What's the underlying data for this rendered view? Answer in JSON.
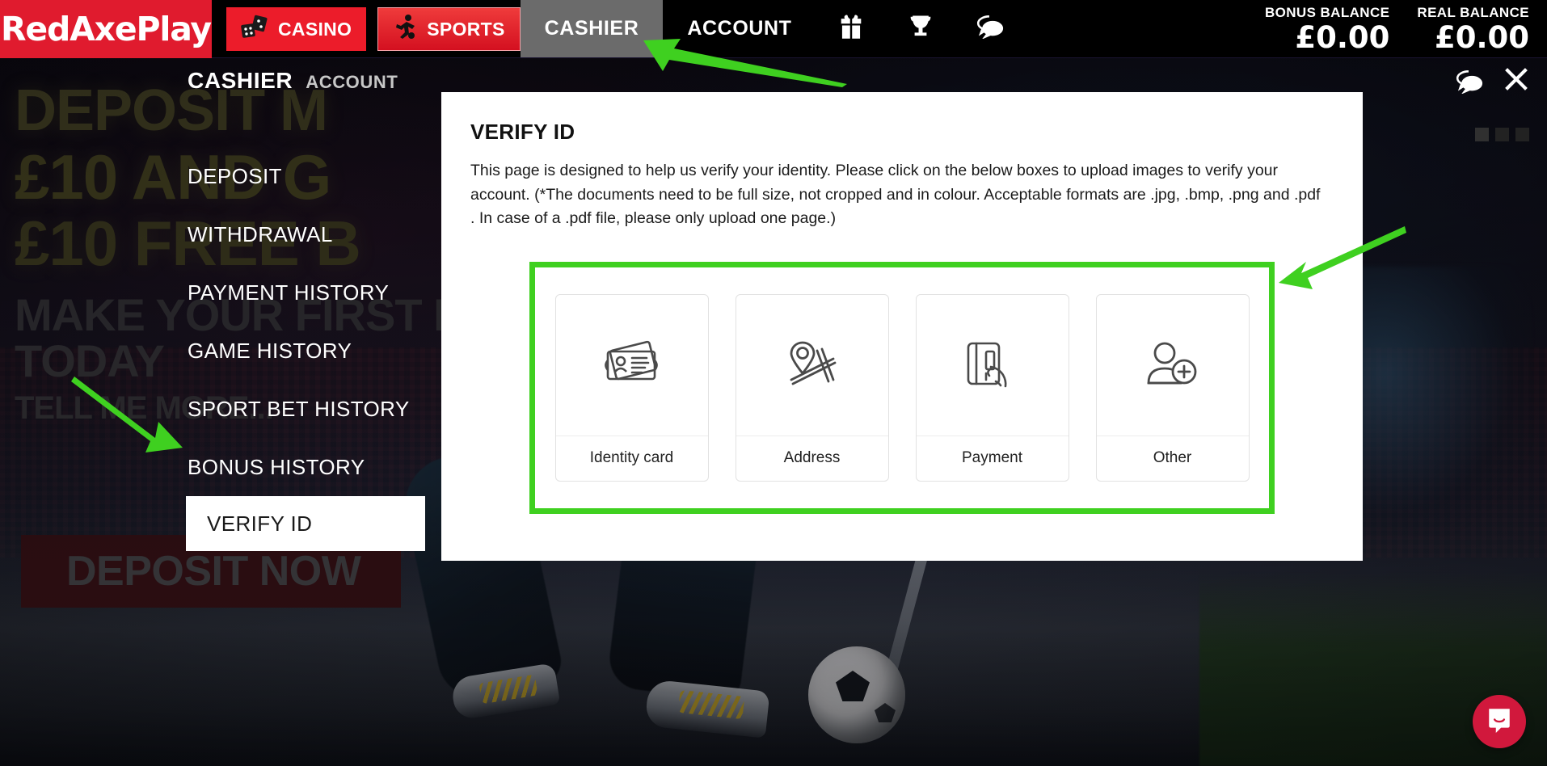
{
  "brand": {
    "name": "RedAxePlay",
    "accent": "#e01b2e",
    "highlight_green": "#3fd020"
  },
  "topnav": {
    "casino_label": "CASINO",
    "sports_label": "SPORTS",
    "cashier_label": "CASHIER",
    "account_label": "ACCOUNT",
    "gift_icon": "gift-icon",
    "trophy_icon": "trophy-icon",
    "chat_icon": "chat-bubbles-icon"
  },
  "balances": {
    "bonus_label": "BONUS BALANCE",
    "bonus_value": "£0.00",
    "real_label": "REAL BALANCE",
    "real_value": "£0.00"
  },
  "panel": {
    "title": "CASHIER",
    "subtitle": "ACCOUNT",
    "chat_icon": "chat-bubbles-icon",
    "close_icon": "close-x-icon"
  },
  "sidebar": {
    "items": [
      {
        "label": "DEPOSIT",
        "selected": false
      },
      {
        "label": "WITHDRAWAL",
        "selected": false
      },
      {
        "label": "PAYMENT HISTORY",
        "selected": false
      },
      {
        "label": "GAME HISTORY",
        "selected": false
      },
      {
        "label": "SPORT BET HISTORY",
        "selected": false
      },
      {
        "label": "BONUS HISTORY",
        "selected": false
      },
      {
        "label": "VERIFY ID",
        "selected": true
      }
    ]
  },
  "modal": {
    "title": "VERIFY ID",
    "description": "This page is designed to help us verify your identity. Please click on the below boxes to upload images to verify your account. (*The documents need to be full size, not cropped and in colour. Acceptable formats are .jpg, .bmp, .png and .pdf . In case of a .pdf file, please only upload one page.)",
    "upload_options": [
      {
        "label": "Identity card",
        "icon": "id-card-icon"
      },
      {
        "label": "Address",
        "icon": "map-pin-icon"
      },
      {
        "label": "Payment",
        "icon": "credit-card-hand-icon"
      },
      {
        "label": "Other",
        "icon": "person-plus-icon"
      }
    ]
  },
  "hero": {
    "line1": "DEPOSIT M",
    "line2": "£10 AND G",
    "line3": "£10 FREE B",
    "line4": "MAKE YOUR FIRST D",
    "line5": "TODAY",
    "line6": "TELL ME MORE...",
    "cta": "DEPOSIT NOW"
  },
  "support": {
    "intercom_icon": "intercom-chat-icon"
  }
}
